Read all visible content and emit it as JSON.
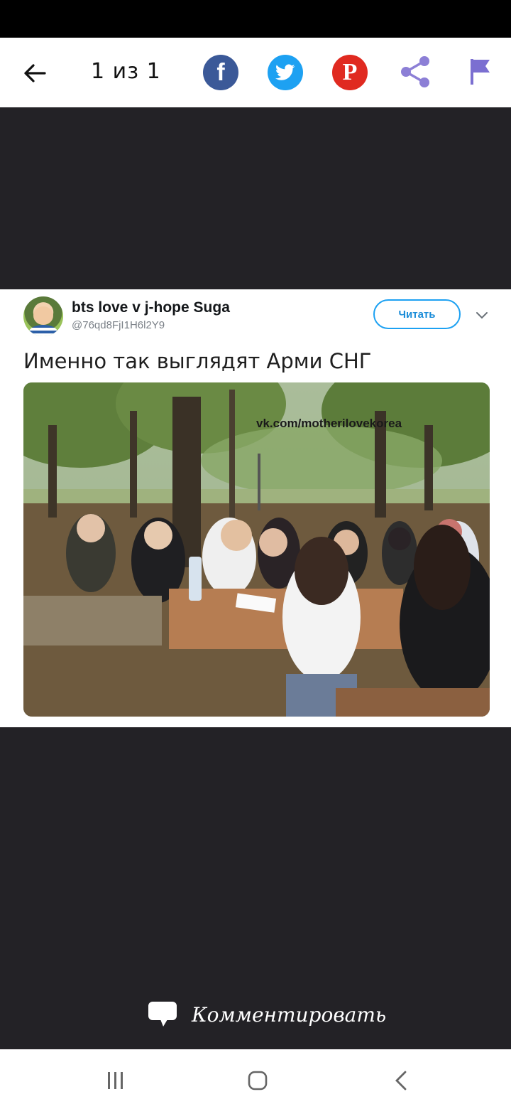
{
  "top_bar": {
    "counter": "1 из 1"
  },
  "share": {
    "facebook_glyph": "f",
    "pinterest_glyph": "P",
    "icons": [
      "back-arrow-icon",
      "facebook-icon",
      "twitter-icon",
      "pinterest-icon",
      "share-icon",
      "flag-icon"
    ]
  },
  "tweet": {
    "user_name": "bts love v j-hope Suga",
    "user_handle": "@76qd8FjI1H6l2Y9",
    "follow_label": "Читать",
    "text": "Именно так выглядят Арми СНГ",
    "image_watermark": "vk.com/motherilovekorea"
  },
  "comment": {
    "label": "Комментировать"
  },
  "colors": {
    "facebook": "#3b5998",
    "twitter": "#1da1f2",
    "pinterest": "#e02a20",
    "share_icon": "#8c7fd6",
    "flag_icon": "#7b6fd1",
    "background": "#232226"
  }
}
